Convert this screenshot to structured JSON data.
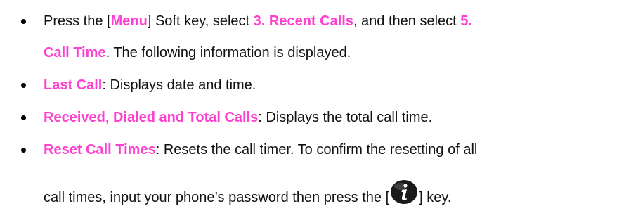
{
  "bullets": [
    {
      "line1": {
        "before": "Press the [",
        "menu": "Menu",
        "mid1": "] Soft key, select ",
        "recent": "3. Recent Calls",
        "mid2": ", and then select ",
        "num": "5."
      },
      "line2": {
        "calltime": "Call Time",
        "after": ". The following information is displayed."
      }
    },
    {
      "term": "Last Call",
      "text": ": Displays date and time."
    },
    {
      "term": "Received, Dialed and Total Calls",
      "text": ": Displays the total call time."
    },
    {
      "term": "Reset Call Times",
      "text": ": Resets the call timer. To confirm the resetting of all",
      "line2_before": "call times, input your phone’s password then press the [",
      "key_icon": "info-key-icon",
      "line2_after": "] key."
    }
  ],
  "colors": {
    "highlight": "#ff3fd0",
    "text": "#111111"
  }
}
